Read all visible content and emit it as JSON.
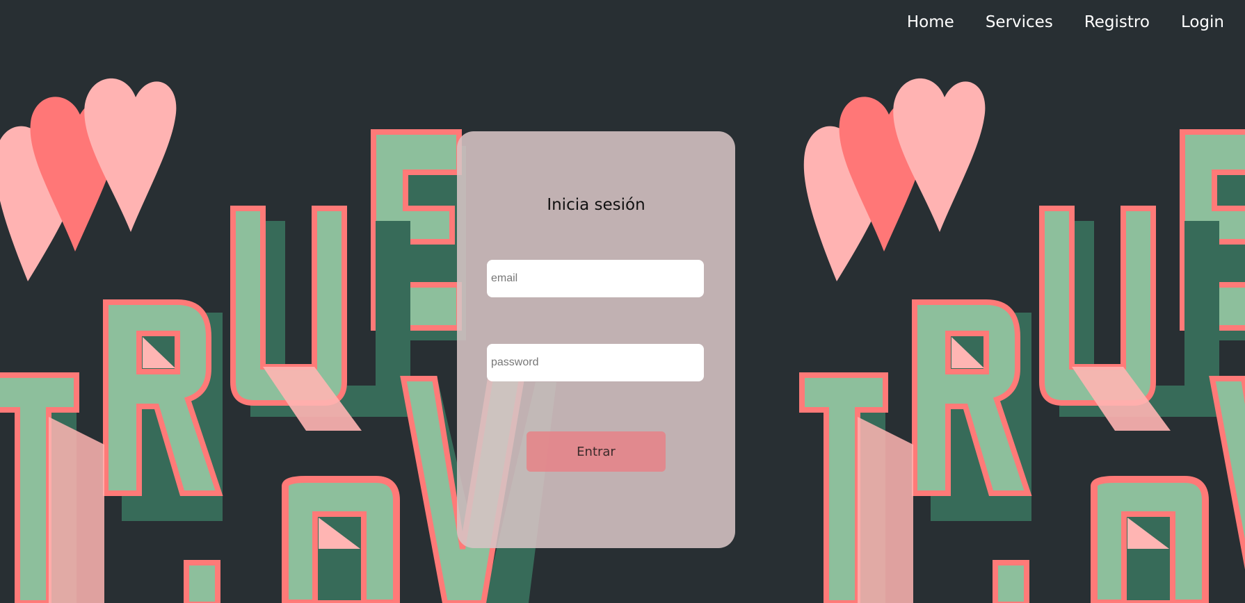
{
  "nav": {
    "items": [
      {
        "label": "Home"
      },
      {
        "label": "Services"
      },
      {
        "label": "Registro"
      },
      {
        "label": "Login"
      }
    ]
  },
  "background": {
    "art_words": [
      "TRUE",
      "LOVE"
    ],
    "colors": {
      "page": "#282f33",
      "letter_fill": "#8dbf9c",
      "letter_outline": "#ff7a78",
      "letter_shadow": "#376b59",
      "letter_highlight": "#ffb5b3",
      "heart_light": "#ffb3b2",
      "heart_dark": "#ff7777"
    }
  },
  "login": {
    "title": "Inicia sesión",
    "email_placeholder": "email",
    "password_placeholder": "password",
    "submit_label": "Entrar",
    "colors": {
      "card": "#d6c4c4",
      "button": "#e68287"
    }
  }
}
